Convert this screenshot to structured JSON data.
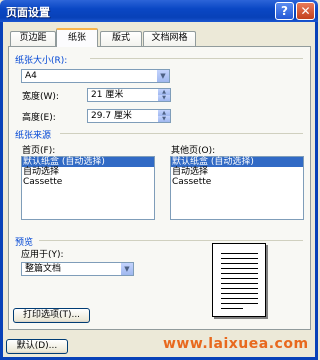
{
  "window": {
    "title": "页面设置",
    "help_glyph": "?",
    "close_glyph": "✕"
  },
  "tabs": [
    {
      "label": "页边距",
      "active": false
    },
    {
      "label": "纸张",
      "active": true
    },
    {
      "label": "版式",
      "active": false
    },
    {
      "label": "文档网格",
      "active": false
    }
  ],
  "paper_size": {
    "group_label": "纸张大小(R):",
    "value": "A4",
    "width_label": "宽度(W):",
    "width_value": "21 厘米",
    "height_label": "高度(E):",
    "height_value": "29.7 厘米"
  },
  "paper_source": {
    "group_label": "纸张来源",
    "first_page_label": "首页(F):",
    "other_pages_label": "其他页(O):",
    "first_page_items": [
      "默认纸盒 (自动选择)",
      "自动选择",
      "Cassette"
    ],
    "other_pages_items": [
      "默认纸盒 (自动选择)",
      "自动选择",
      "Cassette"
    ],
    "selected_index": 0
  },
  "preview": {
    "group_label": "预览",
    "apply_to_label": "应用于(Y):",
    "apply_to_value": "整篇文档"
  },
  "buttons": {
    "print_options": "打印选项(T)...",
    "default": "默认(D)..."
  },
  "watermark": "www.laixuea.com"
}
